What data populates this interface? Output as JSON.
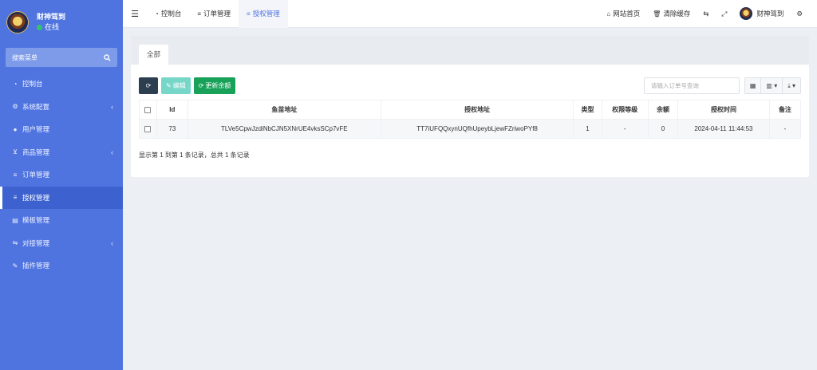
{
  "sidebar": {
    "user_name": "财神驾到",
    "status": "在线",
    "search_label": "搜索菜单",
    "items": [
      {
        "icon": "dashboard-icon",
        "glyph": "◔",
        "label": "控制台",
        "chevron": false,
        "active": false
      },
      {
        "icon": "gear-icon",
        "glyph": "⚙",
        "label": "系统配置",
        "chevron": true,
        "active": false
      },
      {
        "icon": "user-icon",
        "glyph": "●",
        "label": "用户管理",
        "chevron": false,
        "active": false
      },
      {
        "icon": "cart-icon",
        "glyph": "⊻",
        "label": "商品管理",
        "chevron": true,
        "active": false
      },
      {
        "icon": "list-icon",
        "glyph": "≡",
        "label": "订单管理",
        "chevron": false,
        "active": false
      },
      {
        "icon": "list-icon",
        "glyph": "≡",
        "label": "授权管理",
        "chevron": false,
        "active": true
      },
      {
        "icon": "template-icon",
        "glyph": "▤",
        "label": "模板管理",
        "chevron": false,
        "active": false
      },
      {
        "icon": "sliders-icon",
        "glyph": "⇋",
        "label": "对接管理",
        "chevron": true,
        "active": false
      },
      {
        "icon": "plugin-icon",
        "glyph": "✎",
        "label": "插件管理",
        "chevron": false,
        "active": false
      }
    ]
  },
  "topbar": {
    "tabs": [
      {
        "glyph": "◔",
        "label": "控制台",
        "active": false
      },
      {
        "glyph": "≡",
        "label": "订单管理",
        "active": false
      },
      {
        "glyph": "≡",
        "label": "授权管理",
        "active": true
      }
    ],
    "home_label": "网站首页",
    "clear_cache_label": "清除缓存",
    "user_name": "财神驾到"
  },
  "panel": {
    "tab_label": "全部",
    "edit_label": "编辑",
    "update_label": "更新余额",
    "search_placeholder": "请输入订单号查询",
    "columns": [
      "Id",
      "鱼苗地址",
      "授权地址",
      "类型",
      "权限等级",
      "余额",
      "授权时间",
      "备注"
    ],
    "rows": [
      [
        "73",
        "TLVe5CpwJzdiNbCJN5XNrUE4vksSCp7vFE",
        "TT7iUFQQxynUQfhUpeybLjewFZriwoPYf8",
        "1",
        "-",
        "0",
        "2024-04-11 11:44:53",
        "-"
      ]
    ],
    "pagination": "显示第 1 到第 1 条记录，总共 1 条记录"
  },
  "colors": {
    "sidebar_bg": "#4f74e0",
    "accent": "#4e73df",
    "btn_dark": "#2c3e50",
    "btn_teal": "#76d6c8",
    "btn_green": "#18a158"
  }
}
